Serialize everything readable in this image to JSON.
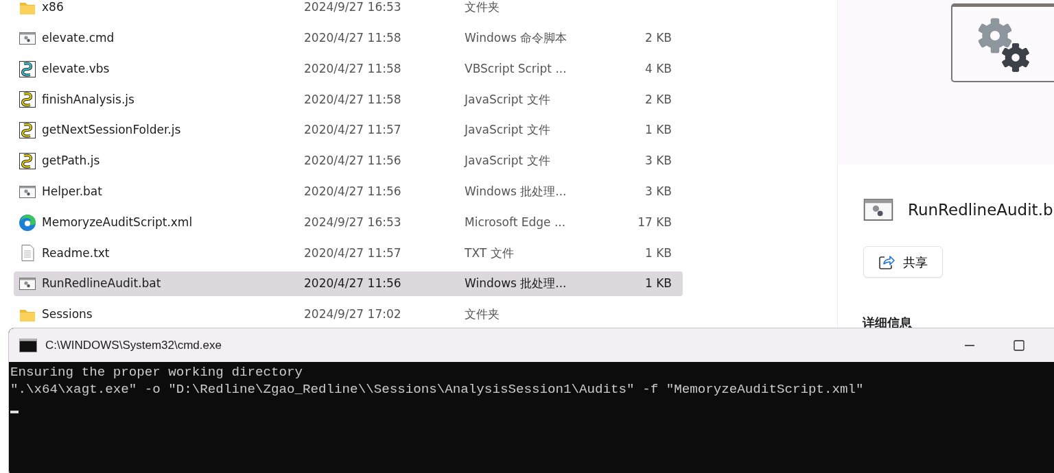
{
  "files": {
    "rows": [
      {
        "kind": "folder",
        "name": "x86",
        "modified": "2024/9/27 16:53",
        "type": "文件夹",
        "selected": false
      },
      {
        "kind": "batch",
        "name": "elevate.cmd",
        "modified": "2020/4/27 11:58",
        "type": "Windows 命令脚本",
        "size": "2 KB",
        "selected": false
      },
      {
        "kind": "script-cyan",
        "name": "elevate.vbs",
        "modified": "2020/4/27 11:58",
        "type": "VBScript Script ...",
        "size": "4 KB",
        "selected": false
      },
      {
        "kind": "script",
        "name": "finishAnalysis.js",
        "modified": "2020/4/27 11:58",
        "type": "JavaScript 文件",
        "size": "2 KB",
        "selected": false
      },
      {
        "kind": "script",
        "name": "getNextSessionFolder.js",
        "modified": "2020/4/27 11:57",
        "type": "JavaScript 文件",
        "size": "1 KB",
        "selected": false
      },
      {
        "kind": "script",
        "name": "getPath.js",
        "modified": "2020/4/27 11:56",
        "type": "JavaScript 文件",
        "size": "3 KB",
        "selected": false
      },
      {
        "kind": "batch",
        "name": "Helper.bat",
        "modified": "2020/4/27 11:56",
        "type": "Windows 批处理...",
        "size": "3 KB",
        "selected": false
      },
      {
        "kind": "edge",
        "name": "MemoryzeAuditScript.xml",
        "modified": "2024/9/27 16:53",
        "type": "Microsoft Edge ...",
        "size": "17 KB",
        "selected": false
      },
      {
        "kind": "text",
        "name": "Readme.txt",
        "modified": "2020/4/27 11:57",
        "type": "TXT 文件",
        "size": "1 KB",
        "selected": false
      },
      {
        "kind": "batch",
        "name": "RunRedlineAudit.bat",
        "modified": "2020/4/27 11:56",
        "type": "Windows 批处理...",
        "size": "1 KB",
        "selected": true
      },
      {
        "kind": "folder",
        "name": "Sessions",
        "modified": "2024/9/27 17:02",
        "type": "文件夹",
        "selected": false
      }
    ]
  },
  "details_pane": {
    "file_name": "RunRedlineAudit.b",
    "share_button": "共享",
    "section_title": "详细信息"
  },
  "console": {
    "title": "C:\\WINDOWS\\System32\\cmd.exe",
    "lines": [
      "Ensuring the proper working directory",
      "\".\\x64\\xagt.exe\" -o \"D:\\Redline\\Zgao_Redline\\\\Sessions\\AnalysisSession1\\Audits\" -f \"MemoryzeAuditScript.xml\""
    ]
  }
}
